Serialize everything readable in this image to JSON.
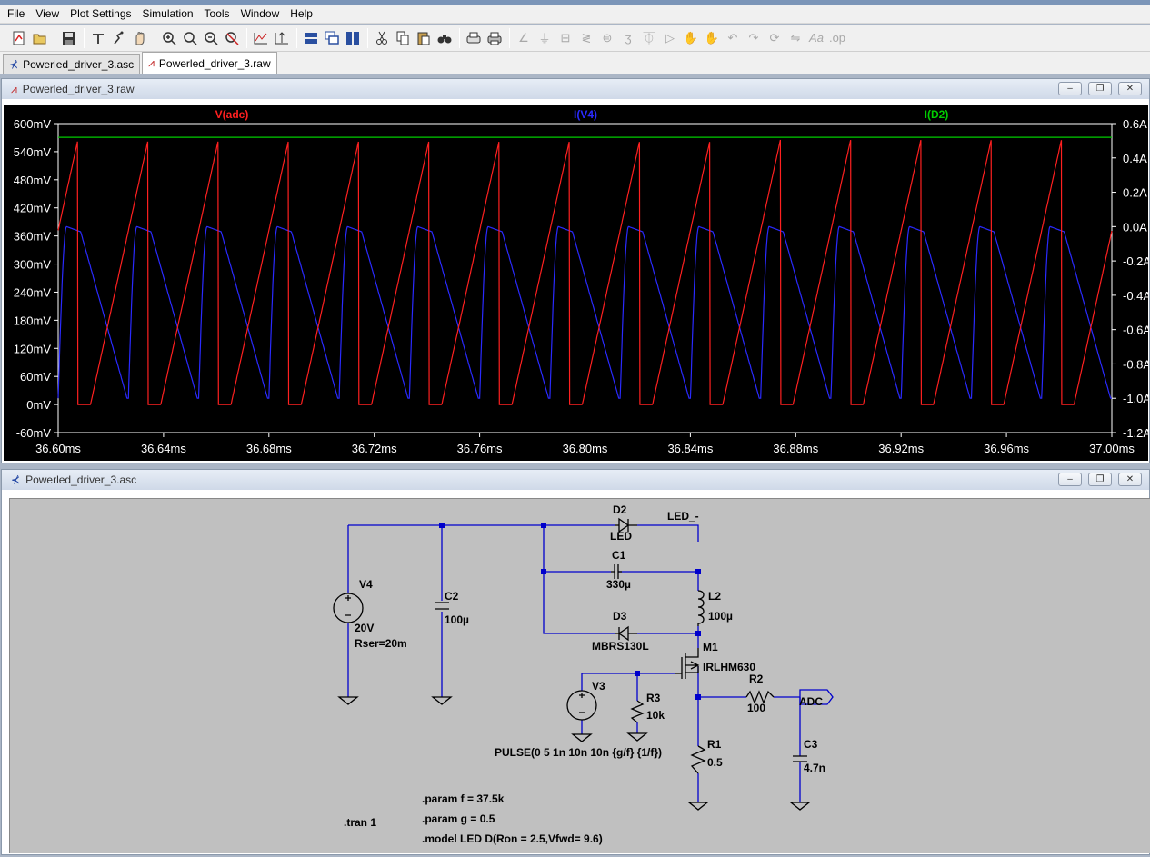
{
  "menu": [
    "File",
    "View",
    "Plot Settings",
    "Simulation",
    "Tools",
    "Window",
    "Help"
  ],
  "toolbar_icons": [
    "new-schematic-icon",
    "open-icon",
    "save-icon",
    "control-panel-icon",
    "run-icon",
    "halt-icon",
    "zoom-in-icon",
    "zoom-fit-icon",
    "zoom-out-icon",
    "zoom-cancel-icon",
    "autorange-icon",
    "autorange-y-icon",
    "tile-horizontal-icon",
    "cascade-icon",
    "tile-vertical-icon",
    "cut-icon",
    "copy-icon",
    "paste-icon",
    "find-icon",
    "print-setup-icon",
    "print-icon",
    "wire-icon",
    "ground-icon",
    "label-icon",
    "resistor-icon",
    "capacitor-icon",
    "inductor-icon",
    "diode-icon",
    "component-icon",
    "move-icon",
    "drag-icon",
    "undo-icon",
    "redo-icon",
    "rotate-icon",
    "mirror-icon",
    "text-icon",
    "spice-directive-icon"
  ],
  "tabs": [
    {
      "label": "Powerled_driver_3.asc",
      "icon": "schematic-icon",
      "active": false
    },
    {
      "label": "Powerled_driver_3.raw",
      "icon": "waveform-icon",
      "active": true
    }
  ],
  "plot_window": {
    "title": "Powerled_driver_3.raw"
  },
  "schematic_window": {
    "title": "Powerled_driver_3.asc"
  },
  "window_buttons": {
    "minimize": "–",
    "restore": "❐",
    "close": "✕"
  },
  "colors": {
    "vadc": "#ff2020",
    "iv4": "#2a2aff",
    "id2": "#00cc00",
    "plot_bg": "#000000",
    "axis_text": "#ffffff",
    "wire": "#0000cc",
    "component": "#000000",
    "label": "#000000"
  },
  "chart_data": {
    "type": "line",
    "title": "",
    "traces": [
      {
        "name": "V(adc)",
        "axis": "left",
        "shape": "sawtooth: rises linearly from 0mV to ~565mV over each period, then drops back to 0mV"
      },
      {
        "name": "I(V4)",
        "axis": "right",
        "shape": "negative pulse: ~0.0A plateau, falls to ~-1.0A"
      },
      {
        "name": "I(D2)",
        "axis": "right",
        "shape": "nearly constant ~0.52A"
      }
    ],
    "series": [
      {
        "name": "V(adc)",
        "unit": "mV",
        "period_ms": 0.02667,
        "min": 0,
        "max": 565
      },
      {
        "name": "I(V4)",
        "unit": "A",
        "period_ms": 0.02667,
        "high": 0.0,
        "low": -1.0
      },
      {
        "name": "I(D2)",
        "unit": "A",
        "value": 0.52
      }
    ],
    "x_axis": {
      "min": 36.6,
      "max": 37.0,
      "unit": "ms",
      "ticks": [
        "36.60ms",
        "36.64ms",
        "36.68ms",
        "36.72ms",
        "36.76ms",
        "36.80ms",
        "36.84ms",
        "36.88ms",
        "36.92ms",
        "36.96ms",
        "37.00ms"
      ]
    },
    "y_left": {
      "min": -60,
      "max": 600,
      "unit": "mV",
      "ticks": [
        "600mV",
        "540mV",
        "480mV",
        "420mV",
        "360mV",
        "300mV",
        "240mV",
        "180mV",
        "120mV",
        "60mV",
        "0mV",
        "-60mV"
      ]
    },
    "y_right": {
      "min": -1.2,
      "max": 0.6,
      "unit": "A",
      "ticks": [
        "0.6A",
        "0.4A",
        "0.2A",
        "0.0A",
        "-0.2A",
        "-0.4A",
        "-0.6A",
        "-0.8A",
        "-1.0A",
        "-1.2A"
      ]
    },
    "legend": "top"
  },
  "schematic": {
    "components": [
      {
        "ref": "D2",
        "value": "LED"
      },
      {
        "ref": "C1",
        "value": "330µ"
      },
      {
        "ref": "L2",
        "value": "100µ"
      },
      {
        "ref": "D3",
        "value": "MBRS130L"
      },
      {
        "ref": "M1",
        "value": "IRLHM630"
      },
      {
        "ref": "V4",
        "value": "20V",
        "extra": "Rser=20m"
      },
      {
        "ref": "C2",
        "value": "100µ"
      },
      {
        "ref": "V3",
        "value": "PULSE(0 5 1n 10n 10n {g/f} {1/f})"
      },
      {
        "ref": "R3",
        "value": "10k"
      },
      {
        "ref": "R2",
        "value": "100"
      },
      {
        "ref": "R1",
        "value": "0.5"
      },
      {
        "ref": "C3",
        "value": "4.7n"
      }
    ],
    "net_labels": [
      "LED_-",
      "ADC"
    ],
    "directives": [
      ".param f = 37.5k",
      ".param g = 0.5",
      ".model LED D(Ron = 2.5,Vfwd= 9.6)",
      ".tran 1"
    ]
  }
}
